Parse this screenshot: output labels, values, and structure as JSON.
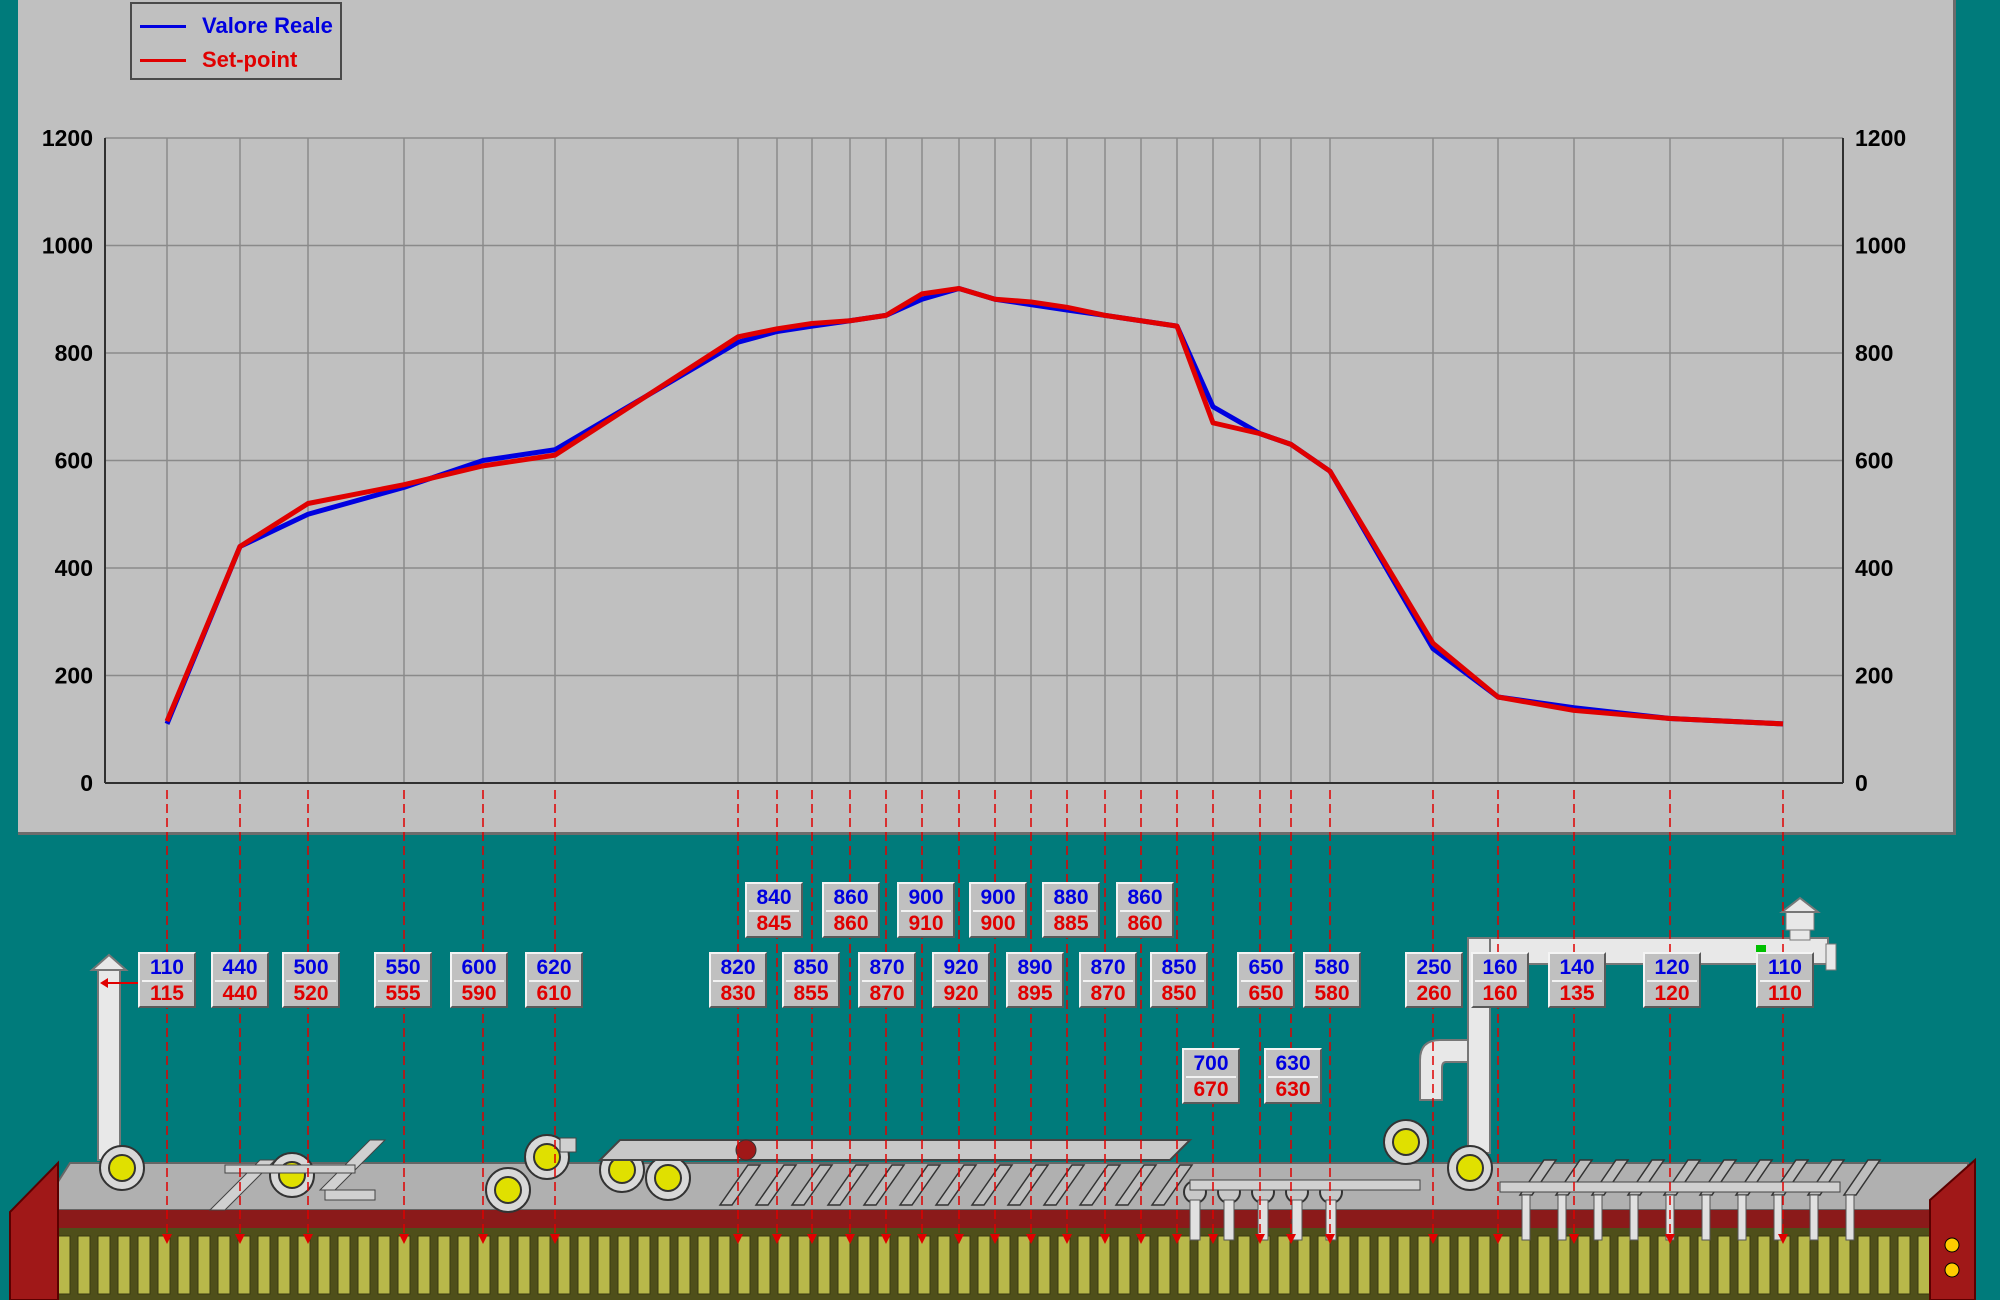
{
  "colors": {
    "background": "#007b7b",
    "panel": "#c0c0c0",
    "real": "#0000e0",
    "setpoint": "#e00000",
    "grid": "#8c8c8c"
  },
  "legend": {
    "real_label": "Valore Reale",
    "setpoint_label": "Set-point"
  },
  "chart_data": {
    "type": "line",
    "ylim": [
      0,
      1200
    ],
    "yticks": [
      "0",
      "200",
      "400",
      "600",
      "800",
      "1000",
      "1200"
    ],
    "grid": true,
    "legend_position": "top-left",
    "series": [
      {
        "name": "Valore Reale",
        "color": "#0000e0",
        "values": [
          110,
          440,
          500,
          550,
          600,
          620,
          820,
          840,
          850,
          860,
          870,
          900,
          920,
          900,
          890,
          880,
          870,
          860,
          850,
          700,
          650,
          630,
          580,
          250,
          160,
          140,
          120,
          110
        ]
      },
      {
        "name": "Set-point",
        "color": "#e00000",
        "values": [
          115,
          440,
          520,
          555,
          590,
          610,
          830,
          845,
          855,
          860,
          870,
          910,
          920,
          900,
          895,
          885,
          870,
          860,
          850,
          670,
          650,
          630,
          580,
          260,
          160,
          135,
          120,
          110
        ]
      }
    ]
  },
  "readouts": [
    {
      "real": "110",
      "set": "115"
    },
    {
      "real": "440",
      "set": "440"
    },
    {
      "real": "500",
      "set": "520"
    },
    {
      "real": "550",
      "set": "555"
    },
    {
      "real": "600",
      "set": "590"
    },
    {
      "real": "620",
      "set": "610"
    },
    {
      "real": "820",
      "set": "830"
    },
    {
      "real": "840",
      "set": "845"
    },
    {
      "real": "850",
      "set": "855"
    },
    {
      "real": "860",
      "set": "860"
    },
    {
      "real": "870",
      "set": "870"
    },
    {
      "real": "900",
      "set": "910"
    },
    {
      "real": "920",
      "set": "920"
    },
    {
      "real": "900",
      "set": "900"
    },
    {
      "real": "890",
      "set": "895"
    },
    {
      "real": "880",
      "set": "885"
    },
    {
      "real": "870",
      "set": "870"
    },
    {
      "real": "860",
      "set": "860"
    },
    {
      "real": "850",
      "set": "850"
    },
    {
      "real": "700",
      "set": "670"
    },
    {
      "real": "650",
      "set": "650"
    },
    {
      "real": "630",
      "set": "630"
    },
    {
      "real": "580",
      "set": "580"
    },
    {
      "real": "250",
      "set": "260"
    },
    {
      "real": "160",
      "set": "160"
    },
    {
      "real": "140",
      "set": "135"
    },
    {
      "real": "120",
      "set": "120"
    },
    {
      "real": "110",
      "set": "110"
    }
  ]
}
